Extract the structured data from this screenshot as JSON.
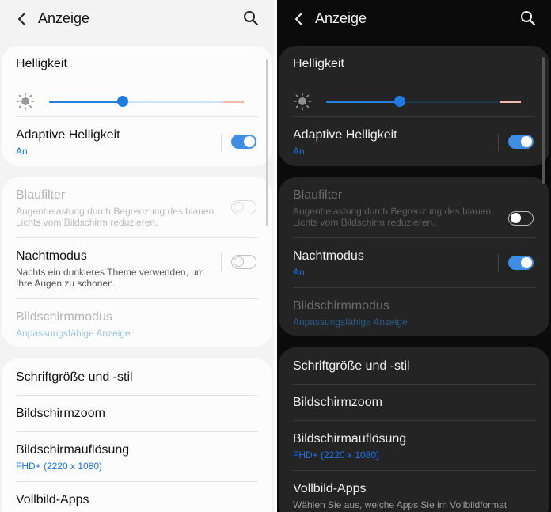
{
  "light": {
    "header": {
      "title": "Anzeige"
    },
    "brightness": {
      "label": "Helligkeit",
      "level": 0.38
    },
    "adaptive": {
      "label": "Adaptive Helligkeit",
      "status": "An",
      "enabled": true
    },
    "bluefilter": {
      "label": "Blaufilter",
      "description": "Augenbelastung durch Begrenzung des blauen Lichts vom Bildschirm reduzieren.",
      "enabled": false
    },
    "nightmode": {
      "label": "Nachtmodus",
      "description": "Nachts ein dunkleres Theme verwenden, um Ihre Augen zu schonen.",
      "enabled": false
    },
    "screenmode": {
      "label": "Bildschirmmodus",
      "value": "Anpassungsfähige Anzeige"
    },
    "font": {
      "label": "Schriftgröße und -stil"
    },
    "zoom": {
      "label": "Bildschirmzoom"
    },
    "resolution": {
      "label": "Bildschirmauflösung",
      "value": "FHD+ (2220 x 1080)"
    },
    "fullscreen": {
      "label": "Vollbild-Apps"
    }
  },
  "dark": {
    "header": {
      "title": "Anzeige"
    },
    "brightness": {
      "label": "Helligkeit",
      "level": 0.38
    },
    "adaptive": {
      "label": "Adaptive Helligkeit",
      "status": "An",
      "enabled": true
    },
    "bluefilter": {
      "label": "Blaufilter",
      "description": "Augenbelastung durch Begrenzung des blauen Lichts vom Bildschirm reduzieren.",
      "enabled": false
    },
    "nightmode": {
      "label": "Nachtmodus",
      "status": "An",
      "enabled": true
    },
    "screenmode": {
      "label": "Bildschirmmodus",
      "value": "Anpassungsfähige Anzeige"
    },
    "font": {
      "label": "Schriftgröße und -stil"
    },
    "zoom": {
      "label": "Bildschirmzoom"
    },
    "resolution": {
      "label": "Bildschirmauflösung",
      "value": "FHD+ (2220 x 1080)"
    },
    "fullscreen": {
      "label": "Vollbild-Apps",
      "description": "Wählen Sie aus, welche Apps Sie im Vollbildformat"
    }
  },
  "colors": {
    "accent": "#1f7be3",
    "light_bg": "#f3f3f3",
    "dark_bg": "#0b0b0b"
  },
  "icons": {
    "back": "chevron-left-icon",
    "search": "search-icon",
    "brightness": "sun-icon"
  }
}
